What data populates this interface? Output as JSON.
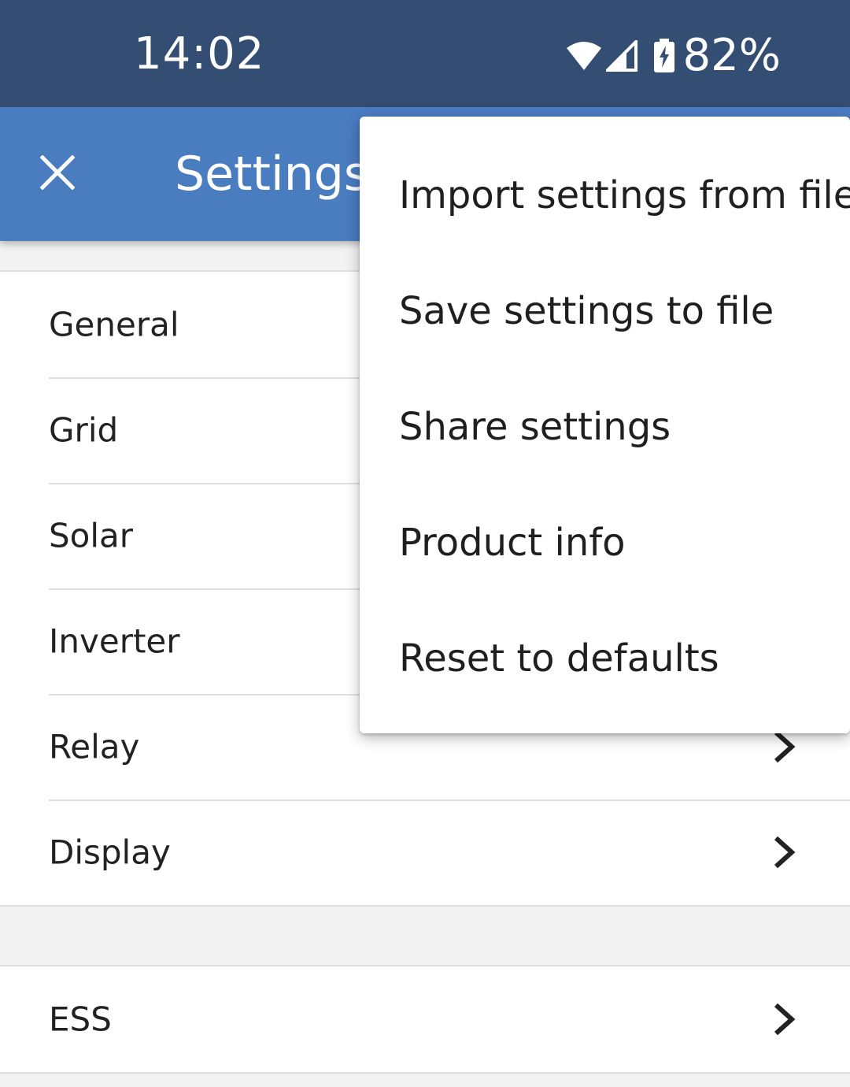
{
  "status_bar": {
    "time": "14:02",
    "battery_percent": "82%",
    "icons": [
      "wifi-icon",
      "cell-signal-icon",
      "battery-charging-icon"
    ]
  },
  "app_bar": {
    "title": "Settings",
    "close_icon": "close-icon"
  },
  "list_main": [
    {
      "label": "General"
    },
    {
      "label": "Grid"
    },
    {
      "label": "Solar"
    },
    {
      "label": "Inverter"
    },
    {
      "label": "Relay"
    },
    {
      "label": "Display"
    }
  ],
  "list_secondary": [
    {
      "label": "ESS"
    }
  ],
  "overflow_menu": {
    "items": [
      {
        "label": "Import settings from file"
      },
      {
        "label": "Save settings to file"
      },
      {
        "label": "Share settings"
      },
      {
        "label": "Product info"
      },
      {
        "label": "Reset to defaults"
      }
    ]
  },
  "colors": {
    "status_bar": "#344d73",
    "app_bar": "#4a7cc0",
    "background": "#f2f2f2"
  }
}
